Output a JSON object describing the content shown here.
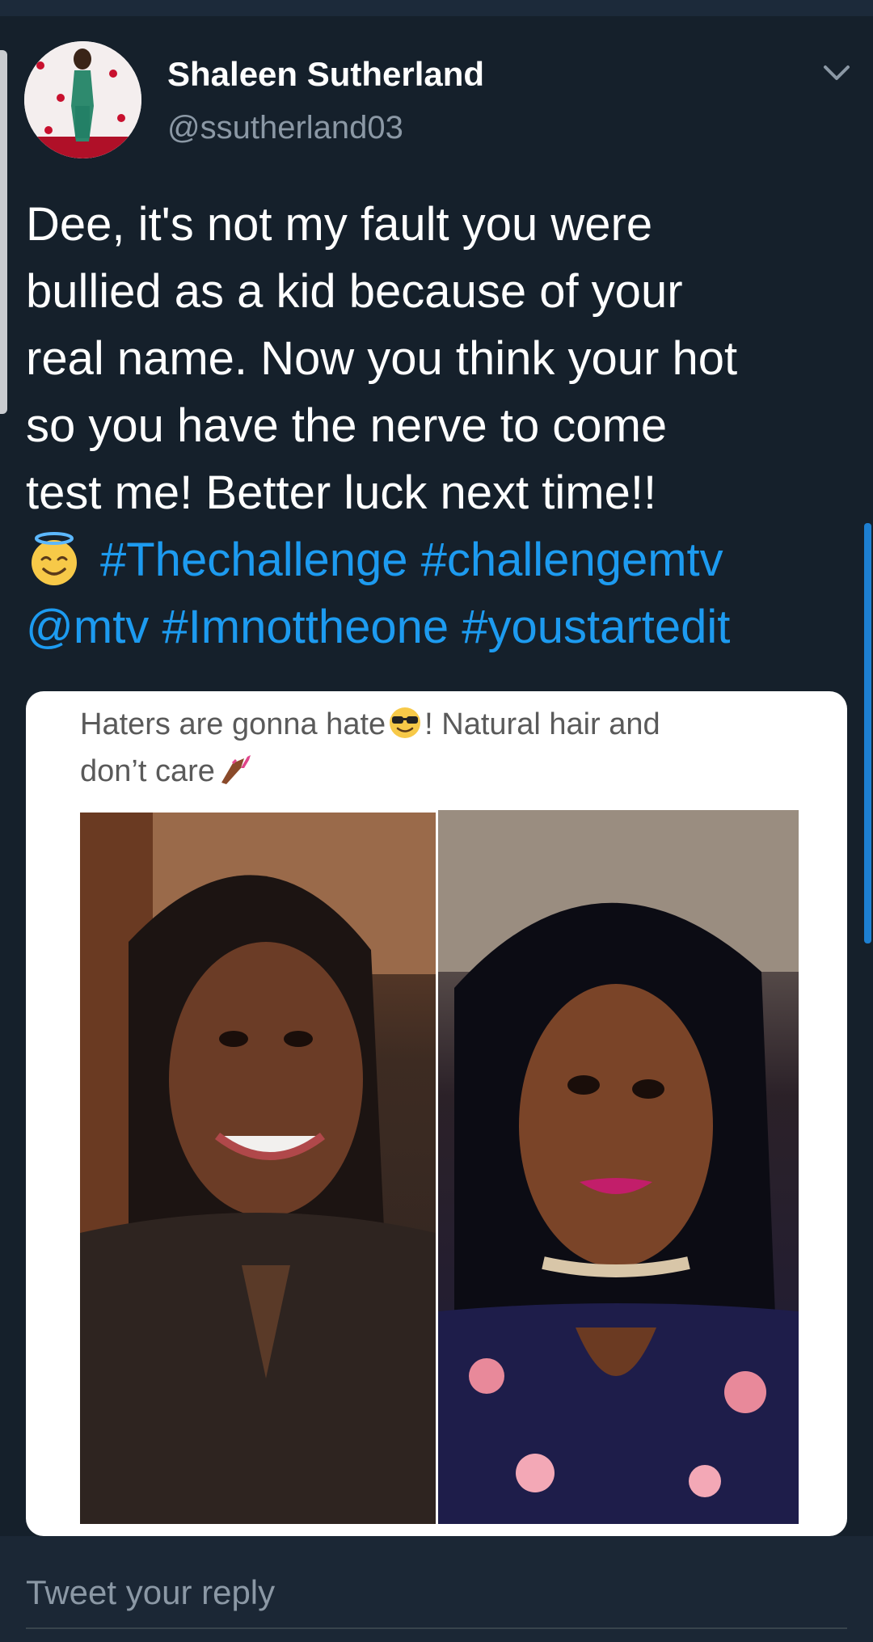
{
  "tweet": {
    "display_name": "Shaleen Sutherland",
    "handle": "@ssutherland03",
    "text_lines": [
      "Dee, it's not my fault you were",
      "bullied as a kid because of your",
      "real name. Now you think your hot",
      "so you have the nerve to come",
      "test me! Better luck next time!!"
    ],
    "emoji_icon": "smiling-face-with-halo-icon",
    "hashtag_thechallenge": "#Thechallenge",
    "hashtag_challengemtv": "#challengemtv",
    "mention_mtv": "@mtv",
    "hashtag_imnottheone": "#Imnottheone",
    "hashtag_youstartedit": "#youstartedit"
  },
  "media": {
    "caption_part1": "Haters are gonna hate",
    "caption_emoji1": "smiling-face-with-sunglasses-icon",
    "caption_part2": "! Natural hair and",
    "caption_part3": "don’t care",
    "caption_emoji2": "nail-polish-icon"
  },
  "reply": {
    "placeholder": "Tweet your reply"
  },
  "colors": {
    "background": "#15202b",
    "link": "#1d9bf0",
    "secondary_text": "#8b98a5"
  }
}
